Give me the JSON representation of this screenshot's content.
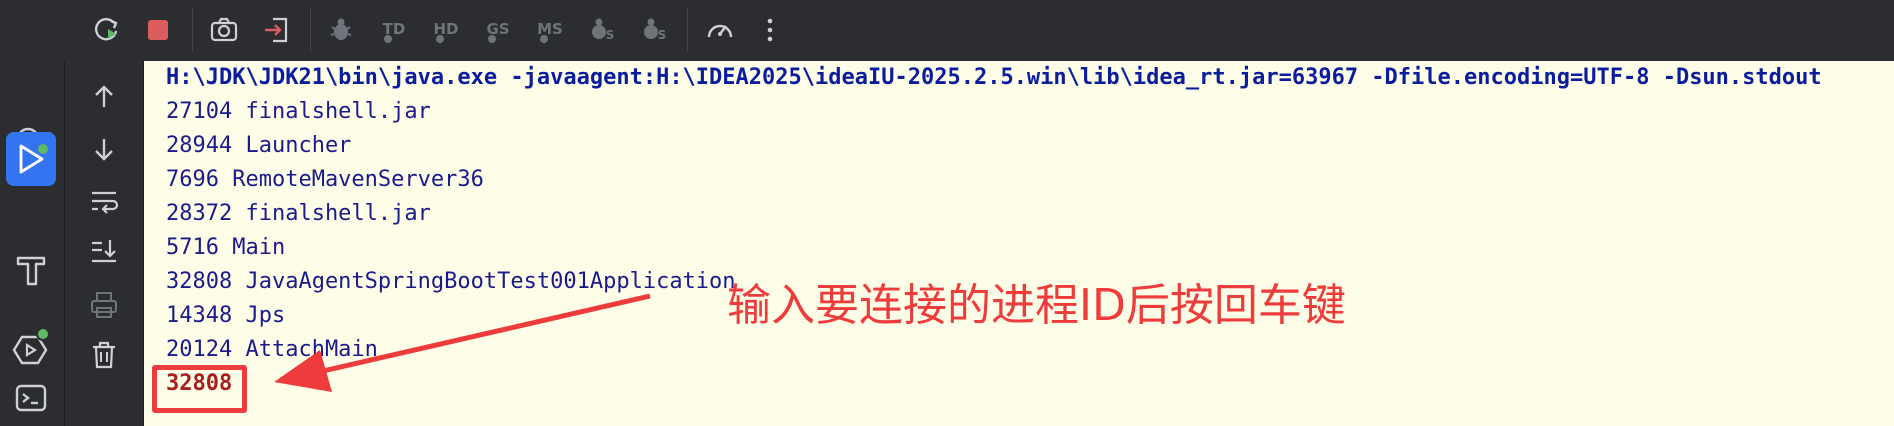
{
  "toolbar": {
    "icons": [
      "rerun-icon",
      "stop-icon",
      "camera-icon",
      "exit-icon",
      "bug-icon",
      "td-icon",
      "hd-icon",
      "gs-icon",
      "ms-icon",
      "profile-icon",
      "profile2-icon",
      "gauge-icon",
      "more-icon"
    ],
    "td_label": "TD",
    "hd_label": "HD",
    "gs_label": "GS",
    "ms_label": "MS"
  },
  "sidebar": {
    "icons": [
      "search-icon",
      "run-icon",
      "build-icon",
      "services-icon",
      "terminal-icon"
    ],
    "active": "run-icon",
    "accent_color": "#3574f0",
    "status_color": "#5fb865"
  },
  "console_toolbar": {
    "icons": [
      "up-arrow-icon",
      "down-arrow-icon",
      "soft-wrap-icon",
      "scroll-to-end-icon",
      "print-icon",
      "trash-icon"
    ]
  },
  "console": {
    "command_line": "H:\\JDK\\JDK21\\bin\\java.exe -javaagent:H:\\IDEA2025\\ideaIU-2025.2.5.win\\lib\\idea_rt.jar=63967 -Dfile.encoding=UTF-8 -Dsun.stdout",
    "lines": [
      "27104 finalshell.jar",
      "28944 Launcher",
      "7696 RemoteMavenServer36",
      "28372 finalshell.jar",
      "5716 Main",
      "32808 JavaAgentSpringBootTest001Application",
      "14348 Jps",
      "20124 AttachMain"
    ],
    "user_input": "32808",
    "background": "#fefee8"
  },
  "annotation": {
    "text": "输入要连接的进程ID后按回车键",
    "color": "#ee3b3b"
  }
}
